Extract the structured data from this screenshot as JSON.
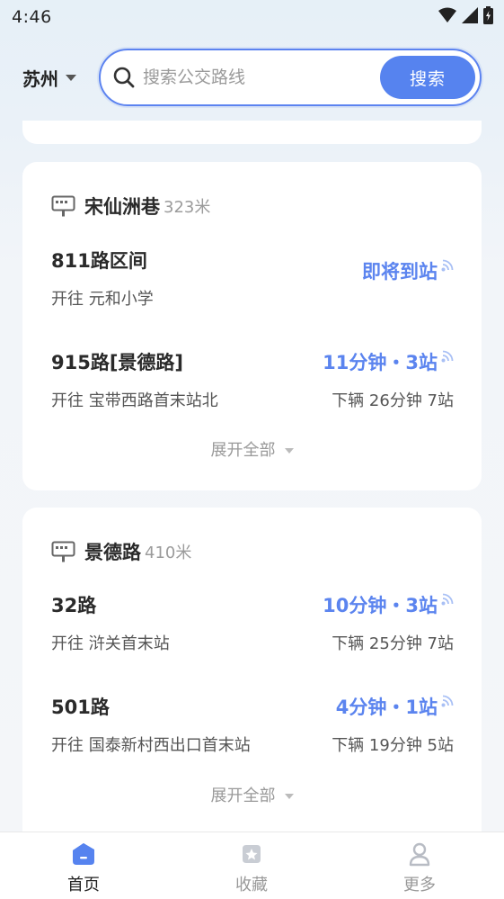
{
  "status_bar": {
    "time": "4:46"
  },
  "header": {
    "city": "苏州",
    "search_placeholder": "搜索公交路线",
    "search_button": "搜索"
  },
  "colors": {
    "accent": "#5683ef",
    "eta": "#5b84ef"
  },
  "stops": [
    {
      "name": "宋仙洲巷",
      "distance": "323米",
      "routes": [
        {
          "name": "811路区间",
          "destination": "开往 元和小学",
          "eta": "即将到站",
          "next": ""
        },
        {
          "name": "915路[景德路]",
          "destination": "开往 宝带西路首末站北",
          "eta": "11分钟・3站",
          "next": "下辆 26分钟 7站"
        }
      ],
      "expand_label": "展开全部"
    },
    {
      "name": "景德路",
      "distance": "410米",
      "routes": [
        {
          "name": "32路",
          "destination": "开往 浒关首末站",
          "eta": "10分钟・3站",
          "next": "下辆 25分钟 7站"
        },
        {
          "name": "501路",
          "destination": "开往 国泰新村西出口首末站",
          "eta": "4分钟・1站",
          "next": "下辆 19分钟 5站"
        }
      ],
      "expand_label": "展开全部"
    }
  ],
  "nav": [
    {
      "label": "首页",
      "icon": "home-icon",
      "active": true
    },
    {
      "label": "收藏",
      "icon": "favorite-icon",
      "active": false
    },
    {
      "label": "更多",
      "icon": "user-icon",
      "active": false
    }
  ]
}
